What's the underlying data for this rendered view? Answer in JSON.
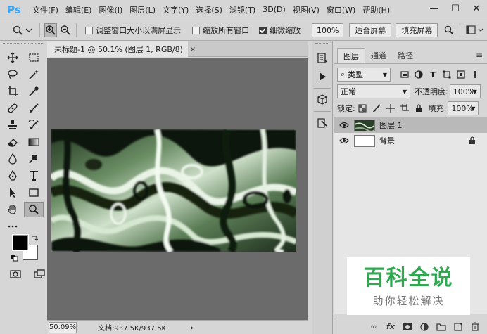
{
  "menu": [
    "文件(F)",
    "编辑(E)",
    "图像(I)",
    "图层(L)",
    "文字(Y)",
    "选择(S)",
    "滤镜(T)",
    "3D(D)",
    "视图(V)",
    "窗口(W)",
    "帮助(H)"
  ],
  "app_logo": "Ps",
  "window_controls": {
    "minimize": "—",
    "maximize": "☐",
    "close": "✕"
  },
  "options": {
    "resize_windows": "调整窗口大小以满屏显示",
    "zoom_all": "缩放所有窗口",
    "scrubby_zoom": "细微缩放",
    "zoom_value": "100%",
    "fit_screen": "适合屏幕",
    "fill_screen": "填充屏幕"
  },
  "document": {
    "tab_title": "未标题-1 @ 50.1% (图层 1, RGB/8)",
    "tab_close": "×",
    "status_zoom": "50.09%",
    "status_doc": "文档:937.5K/937.5K",
    "status_arrow": "›"
  },
  "panel": {
    "tabs": [
      "图层",
      "通道",
      "路径"
    ],
    "filter_kind": "类型",
    "blend_mode": "正常",
    "opacity_label": "不透明度:",
    "opacity_value": "100%",
    "lock_label": "锁定:",
    "fill_label": "填充:",
    "fill_value": "100%",
    "layers": [
      {
        "name": "图层 1",
        "selected": true
      },
      {
        "name": "背景",
        "selected": false
      }
    ],
    "bottom_fx": "fx"
  },
  "watermark": {
    "title": "百科全说",
    "subtitle": "助你轻松解决"
  },
  "colors": {
    "ps_blue": "#31a8ff",
    "watermark_green": "#2fa84f",
    "foreground": "#000000",
    "background": "#ffffff"
  }
}
